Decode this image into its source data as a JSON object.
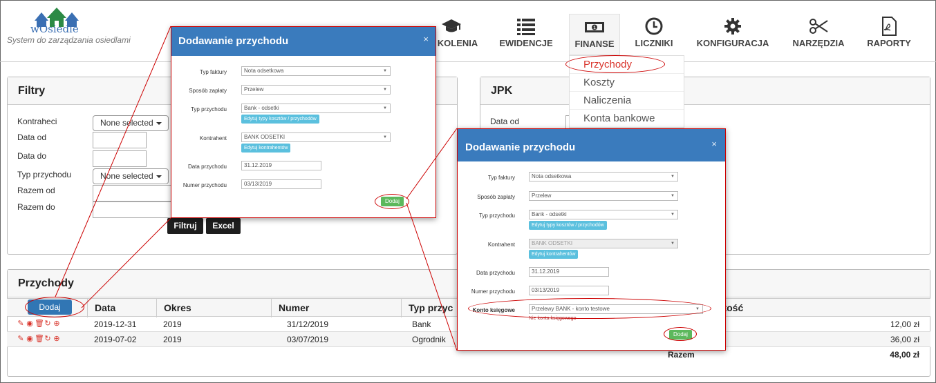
{
  "header": {
    "logo_text": "wOsiedle",
    "tagline": "System do zarządzania osiedlami",
    "nav": [
      {
        "label": "SZKOLENIA",
        "icon": "graduation-cap-icon"
      },
      {
        "label": "EWIDENCJE",
        "icon": "list-icon"
      },
      {
        "label": "FINANSE",
        "icon": "money-icon"
      },
      {
        "label": "LICZNIKI",
        "icon": "clock-icon"
      },
      {
        "label": "KONFIGURACJA",
        "icon": "gear-icon"
      },
      {
        "label": "NARZĘDZIA",
        "icon": "scissors-icon"
      },
      {
        "label": "RAPORTY",
        "icon": "pdf-icon"
      }
    ],
    "nav_first_visible": "KOLENIA"
  },
  "finanse_menu": {
    "items": [
      "Przychody",
      "Koszty",
      "Naliczenia",
      "Konta bankowe"
    ],
    "selected": "Przychody"
  },
  "filters": {
    "title": "Filtry",
    "kontrahenci_label": "Kontraheci",
    "kontrahenci_value": "None selected",
    "data_od_label": "Data od",
    "data_do_label": "Data do",
    "typ_label": "Typ przychodu",
    "typ_value": "None selected",
    "razem_od_label": "Razem od",
    "razem_do_label": "Razem do",
    "filtruj": "Filtruj",
    "excel": "Excel"
  },
  "jpk": {
    "title": "JPK",
    "data_od_label": "Data od"
  },
  "przychody": {
    "title": "Przychody",
    "add_button": "Dodaj",
    "columns": [
      "Data",
      "Okres",
      "Numer",
      "Typ przychodu",
      "Wartość"
    ],
    "col_typ_visible": "Typ przyc",
    "col_wartosc_visible": "rtość",
    "rows": [
      {
        "data": "2019-12-31",
        "okres": "2019",
        "numer": "31/12/2019",
        "typ": "Bank",
        "wartosc": "12,00 zł"
      },
      {
        "data": "2019-07-02",
        "okres": "2019",
        "numer": "03/07/2019",
        "typ": "Ogrodnik",
        "wartosc": "36,00 zł"
      }
    ],
    "total_label": "Razem",
    "total_value": "48,00 zł"
  },
  "modal_small": {
    "title": "Dodawanie przychodu",
    "close": "×",
    "typ_faktury_label": "Typ faktury",
    "typ_faktury_value": "Nota odsetkowa",
    "sposob_label": "Sposób zapłaty",
    "sposob_value": "Przelew",
    "typ_przychodu_label": "Typ przychodu",
    "typ_przychodu_value": "Bank - odsetki",
    "edit_types": "Edytuj typy kosztów / przychodów",
    "kontrahent_label": "Kontrahent",
    "kontrahent_value": "BANK ODSETKI",
    "edit_kontrahent": "Edytuj kontrahentów",
    "data_label": "Data przychodu",
    "data_value": "31.12.2019",
    "numer_label": "Numer przychodu",
    "numer_value": "03/13/2019",
    "submit": "Dodaj"
  },
  "modal_large": {
    "title": "Dodawanie przychodu",
    "close": "×",
    "typ_faktury_label": "Typ faktury",
    "typ_faktury_value": "Nota odsetkowa",
    "sposob_label": "Sposób zapłaty",
    "sposob_value": "Przelew",
    "typ_przychodu_label": "Typ przychodu",
    "typ_przychodu_value": "Bank - odsetki",
    "edit_types": "Edytuj typy kosztów / przychodów",
    "kontrahent_label": "Kontrahent",
    "kontrahent_value": "BANK ODSETKI",
    "edit_kontrahent": "Edytuj kontrahentów",
    "data_label": "Data przychodu",
    "data_value": "31.12.2019",
    "numer_label": "Numer przychodu",
    "numer_value": "03/13/2019",
    "konto_label": "Konto księgowe",
    "konto_value": "Przelewy BANK - konto testowe",
    "konto_hint": "Nie konta księgowego",
    "submit": "Dodaj"
  },
  "colors": {
    "primary": "#3a7bbd",
    "accent_red": "#d9342b",
    "success": "#5cb85c",
    "info": "#5bc0de"
  }
}
